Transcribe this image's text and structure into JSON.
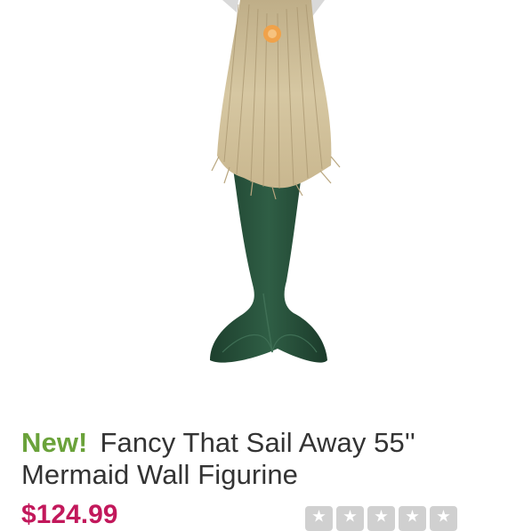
{
  "product": {
    "badge": "New!",
    "title": "Fancy That Sail Away 55'' Mermaid Wall Figurine",
    "price": "$124.99"
  },
  "rating": {
    "stars_filled": 0,
    "stars_total": 5
  },
  "colors": {
    "badge": "#6aa23a",
    "price": "#c2185b",
    "title": "#333333",
    "tail": "#25503a",
    "hair": "#cdbb94"
  }
}
